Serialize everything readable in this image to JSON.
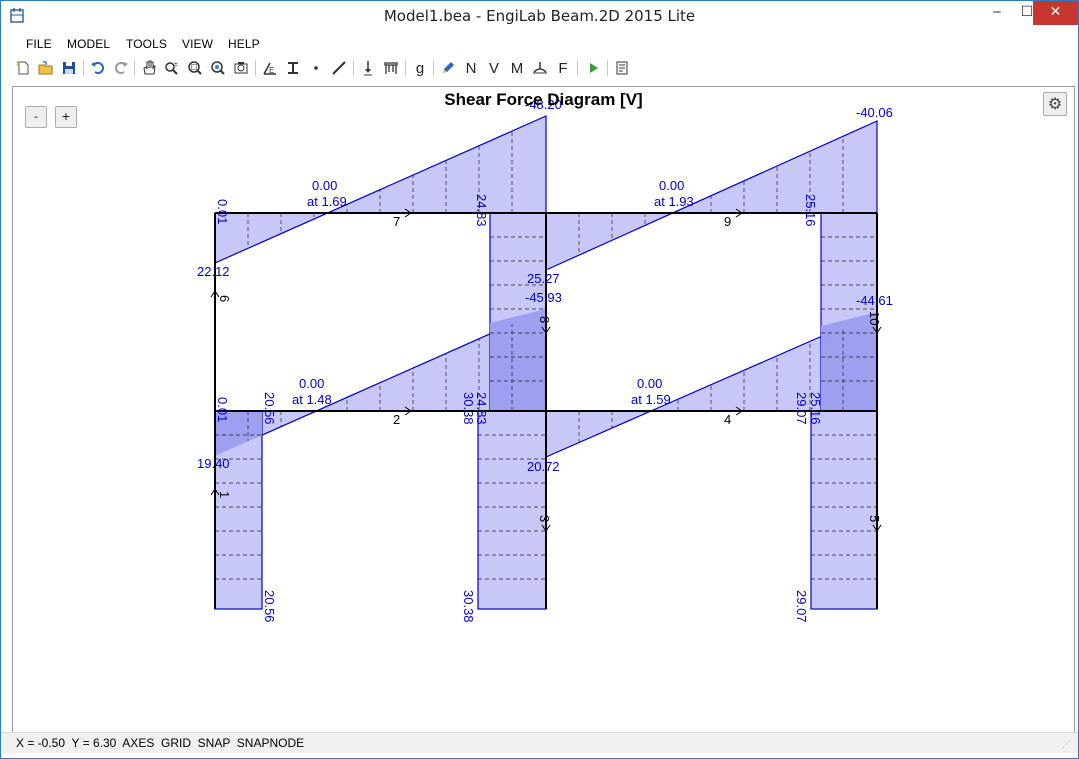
{
  "window": {
    "title": "Model1.bea - EngiLab Beam.2D 2015 Lite",
    "minimize_glyph": "‒",
    "maximize_glyph": "☐",
    "close_glyph": "✕"
  },
  "menu": {
    "items": [
      "FILE",
      "MODEL",
      "TOOLS",
      "VIEW",
      "HELP"
    ]
  },
  "toolbar": {
    "icons": [
      "new-file-icon",
      "open-file-icon",
      "save-icon",
      "undo-icon",
      "redo-icon",
      "pan-icon",
      "zoom-in-out-icon",
      "zoom-window-icon",
      "zoom-extents-icon",
      "zoom-all-icon",
      "materials-icon",
      "sections-icon",
      "node-icon",
      "element-icon",
      "support-icon",
      "hinge-icon",
      "gravity-icon",
      "loads-pen-icon",
      "axial-icon",
      "shear-icon",
      "moment-icon",
      "deformed-icon",
      "reactions-icon",
      "run-icon",
      "report-icon"
    ],
    "glyphs": {
      "loads_n": "N",
      "shear_v": "V",
      "moment_m": "M",
      "reactions_f": "F",
      "gravity": "g"
    }
  },
  "canvas": {
    "zoom_out_label": "-",
    "zoom_in_label": "+",
    "gear_glyph": "⚙",
    "diagram_title": "Shear Force Diagram [V]",
    "fill_color": "#c8c8f8",
    "line_color": "#0000cc",
    "label_color": "#0000cc",
    "frame_color": "#000000"
  },
  "diagram_labels": {
    "beam7": {
      "left_end": "0.01",
      "left_value": "22.12",
      "zero": "0.00",
      "zero_at": "at 1.69",
      "right_end": "24.83",
      "right_peak": "-48.20",
      "element": "7"
    },
    "beam9": {
      "left_value": "25.27",
      "zero": "0.00",
      "zero_at": "at 1.93",
      "right_end": "25.16",
      "right_peak": "-40.06",
      "element": "9"
    },
    "beam2": {
      "left_end": "0.01",
      "left_value": "19.40",
      "zero": "0.00",
      "zero_at": "at 1.48",
      "right_end": "24.83",
      "right_peak": "-45.93",
      "element": "2"
    },
    "beam4": {
      "left_value": "20.72",
      "zero": "0.00",
      "zero_at": "at 1.59",
      "right_end": "25.16",
      "right_peak": "-44.61",
      "element": "4"
    },
    "col1": {
      "top": "20.56",
      "bottom": "20.56",
      "element": "1"
    },
    "col3": {
      "top": "30.38",
      "bottom": "30.38",
      "element": "3"
    },
    "col5": {
      "top": "29.07",
      "bottom": "29.07",
      "element": "5"
    },
    "col6": {
      "element": "6"
    },
    "col8": {
      "element": "8"
    },
    "col10": {
      "element": "10"
    }
  },
  "status": {
    "text": "X = -0.50  Y = 6.30  AXES  GRID  SNAP  SNAPNODE",
    "grip_glyph": "⋰"
  }
}
